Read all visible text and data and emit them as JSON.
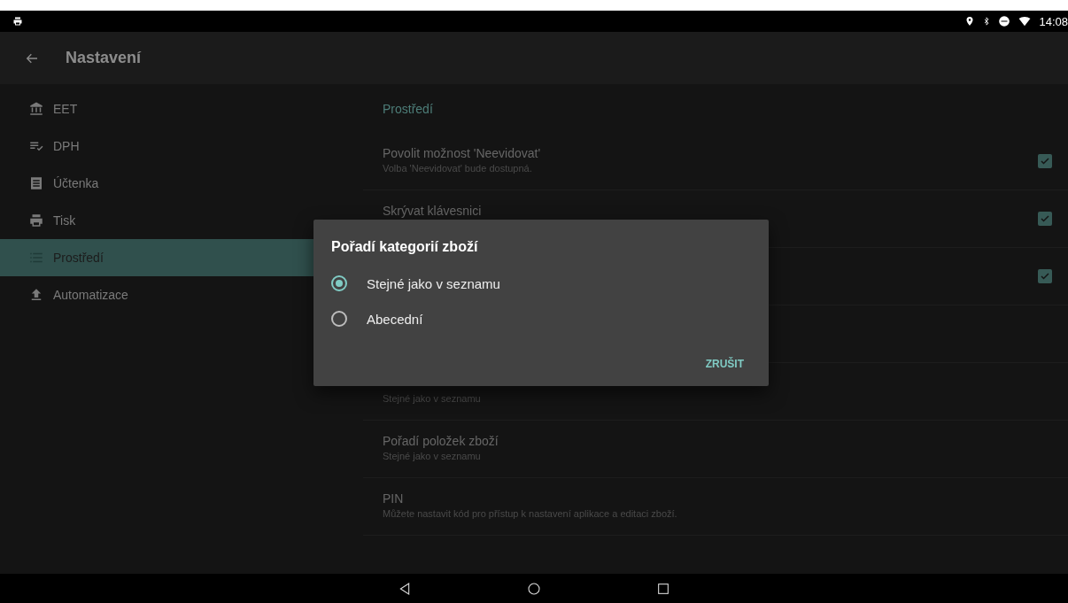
{
  "status_bar": {
    "time": "14:08"
  },
  "toolbar": {
    "title": "Nastavení"
  },
  "sidebar": {
    "items": [
      {
        "label": "EET",
        "selected": false
      },
      {
        "label": "DPH",
        "selected": false
      },
      {
        "label": "Účtenka",
        "selected": false
      },
      {
        "label": "Tisk",
        "selected": false
      },
      {
        "label": "Prostředí",
        "selected": true
      },
      {
        "label": "Automatizace",
        "selected": false
      }
    ]
  },
  "content": {
    "header": "Prostředí",
    "rows": [
      {
        "kind": "checkbox",
        "title": "Povolit možnost 'Neevidovat'",
        "subtitle": "Volba 'Neevidovat' bude dostupná.",
        "checked": true
      },
      {
        "kind": "checkbox",
        "title": "Skrývat klávesnici",
        "checked": true
      },
      {
        "kind": "checkbox",
        "checked": true
      },
      {
        "kind": "covered"
      },
      {
        "kind": "value",
        "subtitle": "Stejné jako v seznamu"
      },
      {
        "kind": "value",
        "title": "Pořadí položek zboží",
        "subtitle": "Stejné jako v seznamu"
      },
      {
        "kind": "value",
        "title": "PIN",
        "subtitle": "Můžete nastavit kód pro přístup k nastavení aplikace a editaci zboží."
      }
    ]
  },
  "dialog": {
    "title": "Pořadí kategorií zboží",
    "options": [
      {
        "label": "Stejné jako v seznamu",
        "selected": true
      },
      {
        "label": "Abecední",
        "selected": false
      }
    ],
    "button": "ZRUŠIT"
  }
}
